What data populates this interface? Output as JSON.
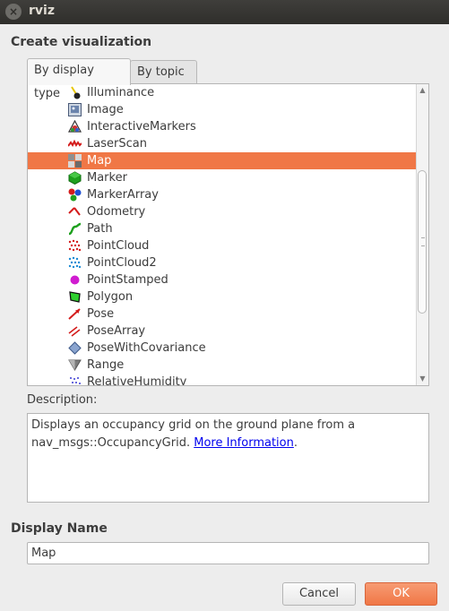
{
  "window": {
    "title": "rviz",
    "close_glyph": "×"
  },
  "header": {
    "title": "Create visualization"
  },
  "tabs": [
    {
      "label": "By display type",
      "active": true
    },
    {
      "label": "By topic",
      "active": false
    }
  ],
  "list": {
    "selected_index": 4,
    "items": [
      {
        "label": "Illuminance",
        "icon": "illuminance-icon"
      },
      {
        "label": "Image",
        "icon": "image-icon"
      },
      {
        "label": "InteractiveMarkers",
        "icon": "interactive-markers-icon"
      },
      {
        "label": "LaserScan",
        "icon": "laser-scan-icon"
      },
      {
        "label": "Map",
        "icon": "map-icon"
      },
      {
        "label": "Marker",
        "icon": "marker-icon"
      },
      {
        "label": "MarkerArray",
        "icon": "marker-array-icon"
      },
      {
        "label": "Odometry",
        "icon": "odometry-icon"
      },
      {
        "label": "Path",
        "icon": "path-icon"
      },
      {
        "label": "PointCloud",
        "icon": "point-cloud-icon"
      },
      {
        "label": "PointCloud2",
        "icon": "point-cloud2-icon"
      },
      {
        "label": "PointStamped",
        "icon": "point-stamped-icon"
      },
      {
        "label": "Polygon",
        "icon": "polygon-icon"
      },
      {
        "label": "Pose",
        "icon": "pose-icon"
      },
      {
        "label": "PoseArray",
        "icon": "pose-array-icon"
      },
      {
        "label": "PoseWithCovariance",
        "icon": "pose-with-covariance-icon"
      },
      {
        "label": "Range",
        "icon": "range-icon"
      },
      {
        "label": "RelativeHumidity",
        "icon": "relative-humidity-icon"
      }
    ]
  },
  "description": {
    "label": "Description:",
    "text": "Displays an occupancy grid on the ground plane from a nav_msgs::OccupancyGrid. ",
    "link_text": "More Information",
    "trailing": "."
  },
  "display_name": {
    "title": "Display Name",
    "value": "Map"
  },
  "buttons": {
    "cancel": "Cancel",
    "ok": "OK"
  },
  "colors": {
    "selection": "#f07746",
    "titlebar": "#3a3935",
    "link": "#0000ee"
  }
}
